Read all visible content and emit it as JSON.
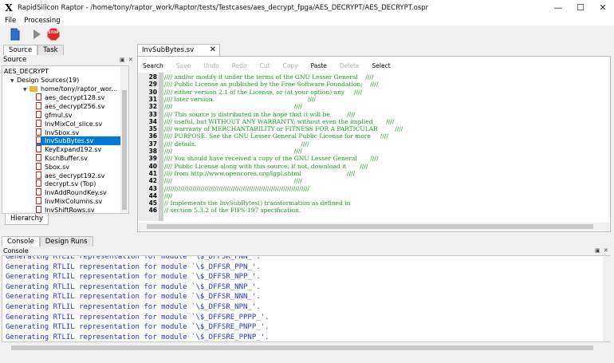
{
  "window": {
    "title": "RapidSilicon Raptor - /home/tony/raptor_work/Raptor/tests/Testcases/aes_decrypt_fpga/AES_DECRYPT/AES_DECRYPT.ospr",
    "logo_text": "X",
    "minimize": "—",
    "maximize": "☐",
    "close": "✕"
  },
  "menu": [
    "File",
    "Processing"
  ],
  "toolbar": {
    "new_file_icon": "document-icon",
    "run_icon": "play-icon",
    "stop_label": "STOP"
  },
  "left_panel": {
    "tabs": [
      "Source",
      "Task"
    ],
    "header": "Source",
    "dock_buttons": "▣ ✕",
    "bottom_tab": "Hierarchy",
    "tree": [
      {
        "label": "AES_DECRYPT",
        "depth": 0,
        "type": "project"
      },
      {
        "label": "Design Sources(19)",
        "depth": 1,
        "type": "group",
        "expanded": true
      },
      {
        "label": "home/tony/raptor_wor...",
        "depth": 2,
        "type": "folder",
        "expanded": true
      },
      {
        "label": "aes_decrypt128.sv",
        "depth": 3,
        "type": "file"
      },
      {
        "label": "aes_decrypt256.sv",
        "depth": 3,
        "type": "file"
      },
      {
        "label": "gfmul.sv",
        "depth": 3,
        "type": "file"
      },
      {
        "label": "InvMixCol_slice.sv",
        "depth": 3,
        "type": "file"
      },
      {
        "label": "InvSbox.sv",
        "depth": 3,
        "type": "file"
      },
      {
        "label": "InvSubBytes.sv",
        "depth": 3,
        "type": "file",
        "selected": true
      },
      {
        "label": "KeyExpand192.sv",
        "depth": 3,
        "type": "file"
      },
      {
        "label": "KschBuffer.sv",
        "depth": 3,
        "type": "file"
      },
      {
        "label": "Sbox.sv",
        "depth": 3,
        "type": "file"
      },
      {
        "label": "aes_decrypt192.sv",
        "depth": 3,
        "type": "file"
      },
      {
        "label": "decrypt.sv (Top)",
        "depth": 3,
        "type": "file"
      },
      {
        "label": "InvAddRoundKey.sv",
        "depth": 3,
        "type": "file"
      },
      {
        "label": "InvMixColumns.sv",
        "depth": 3,
        "type": "file"
      },
      {
        "label": "InvShiftRows.sv",
        "depth": 3,
        "type": "file"
      }
    ]
  },
  "editor": {
    "tab_label": "InvSubBytes.sv",
    "close_icon": "✕",
    "toolbar": [
      {
        "label": "Search",
        "enabled": true
      },
      {
        "label": "Save",
        "enabled": false
      },
      {
        "label": "Undo",
        "enabled": false
      },
      {
        "label": "Redo",
        "enabled": false
      },
      {
        "label": "Cut",
        "enabled": false
      },
      {
        "label": "Copy",
        "enabled": false
      },
      {
        "label": "Paste",
        "enabled": true
      },
      {
        "label": "Delete",
        "enabled": false
      },
      {
        "label": "Select",
        "enabled": true
      }
    ],
    "lines": [
      {
        "n": "28",
        "text": "//// and/or modify it under the terms of the GNU Lesser General    ////"
      },
      {
        "n": "29",
        "text": "//// Public License as published by the Free Software Foundation;    ////"
      },
      {
        "n": "30",
        "text": "//// either version 2.1 of the License, or (at your option) any     ////"
      },
      {
        "n": "31",
        "text": "//// later version.                                                 ////"
      },
      {
        "n": "32",
        "text": "////                                                                ////"
      },
      {
        "n": "33",
        "text": "//// This source is distributed in the hope that it will be         ////"
      },
      {
        "n": "34",
        "text": "//// useful, but WITHOUT ANY WARRANTY; without even the implied       ////"
      },
      {
        "n": "35",
        "text": "//// warranty of MERCHANTABILITY or FITNESS FOR A PARTICULAR         ////"
      },
      {
        "n": "36",
        "text": "//// PURPOSE. See the GNU Lesser General Public License for more     ////"
      },
      {
        "n": "37",
        "text": "//// details.                                                       ////"
      },
      {
        "n": "38",
        "text": "////                                                                ////"
      },
      {
        "n": "39",
        "text": "//// You should have received a copy of the GNU Lesser General       ////"
      },
      {
        "n": "40",
        "text": "//// Public License along with this source; if not, download it       ////"
      },
      {
        "n": "41",
        "text": "//// from http://www.opencores.org/lgpl.shtml                        ////"
      },
      {
        "n": "42",
        "text": "////                                                                ////"
      },
      {
        "n": "43",
        "text": "////////////////////////////////////////////////////////////////////////"
      },
      {
        "n": "44",
        "text": "////"
      },
      {
        "n": "45",
        "text": "// Implements the InvSubBytes() transformation as defined in"
      },
      {
        "n": "46",
        "text": "// section 5.3.2 of the FIPS-197 specification."
      }
    ]
  },
  "bottom_panel": {
    "tabs": [
      "Console",
      "Design Runs"
    ],
    "header": "Console",
    "dock_buttons": "▣ ✕",
    "lines": [
      "Generating RTLIL representation for module `\\$_DFFSR_PNN_'.",
      "Generating RTLIL representation for module `\\$_DFFSR_PPN_'.",
      "Generating RTLIL representation for module `\\$_DFFSR_NPP_'.",
      "Generating RTLIL representation for module `\\$_DFFSR_NNP_'.",
      "Generating RTLIL representation for module `\\$_DFFSR_NNN_'.",
      "Generating RTLIL representation for module `\\$_DFFSR_NPN_'.",
      "Generating RTLIL representation for module `\\$_DFFSRE_PPPP_'.",
      "Generating RTLIL representation for module `\\$_DFFSRE_PNPP_'.",
      "Generating RTLIL representation for module `\\$_DFFSRE_PPNP_'."
    ]
  }
}
